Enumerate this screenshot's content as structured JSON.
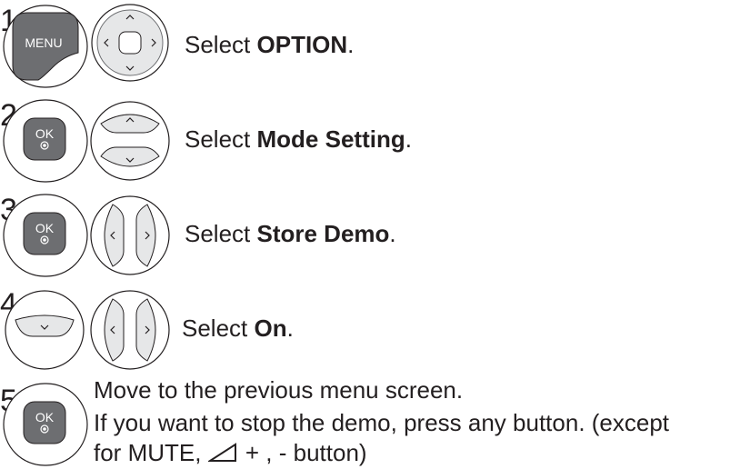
{
  "steps": [
    {
      "number": "1",
      "prefix": "Select ",
      "bold": "OPTION",
      "suffix": ".",
      "buttons": [
        "menu-button",
        "nav-pad"
      ]
    },
    {
      "number": "2",
      "prefix": "Select ",
      "bold": "Mode Setting",
      "suffix": ".",
      "buttons": [
        "ok-button",
        "up-down-buttons"
      ]
    },
    {
      "number": "3",
      "prefix": "Select ",
      "bold": "Store Demo",
      "suffix": ".",
      "buttons": [
        "ok-button",
        "left-right-buttons"
      ]
    },
    {
      "number": "4",
      "prefix": "Select ",
      "bold": "On",
      "suffix": ".",
      "buttons": [
        "down-button",
        "left-right-buttons"
      ]
    },
    {
      "number": "5",
      "lines": [
        "Move to the previous menu screen.",
        "If you want to stop the demo, press any button. (except",
        "for MUTE, ",
        " + , - button)"
      ],
      "buttons": [
        "ok-button"
      ]
    }
  ],
  "labels": {
    "menu": "MENU",
    "ok": "OK"
  },
  "icons": {
    "volume": "volume-icon"
  },
  "colors": {
    "button_dark": "#6d6e71",
    "button_face": "#d1d3d4",
    "outline": "#231f20",
    "text": "#231f20"
  }
}
